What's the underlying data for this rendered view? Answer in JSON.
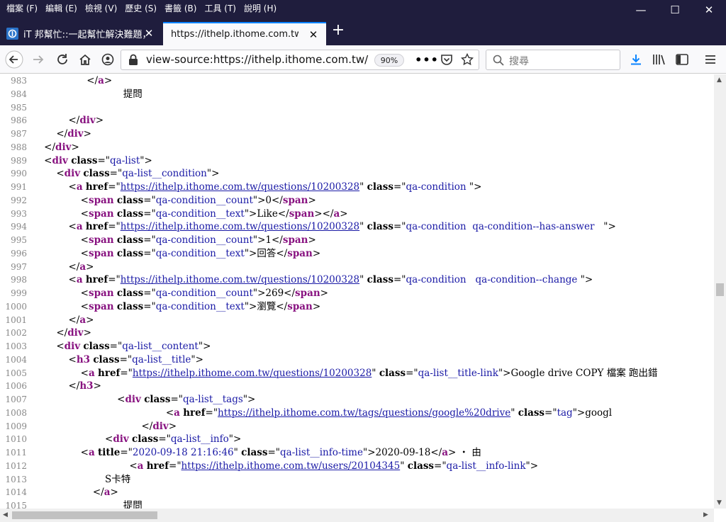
{
  "menu": [
    "檔案 (F)",
    "編輯 (E)",
    "檢視 (V)",
    "歷史 (S)",
    "書籤 (B)",
    "工具 (T)",
    "說明 (H)"
  ],
  "tabs": [
    {
      "title": "iT 邦幫忙::一起幫忙解決難題，拯救 IT 人的一天"
    },
    {
      "title": "https://ithelp.ithome.com.tw/"
    }
  ],
  "url": "view-source:https://ithelp.ithome.com.tw/",
  "zoom": "90%",
  "search_placeholder": "搜尋",
  "lines": [
    {
      "n": "983",
      "html": "                  &lt;/<span class='t'>a</span>&gt;"
    },
    {
      "n": "984",
      "html": "                              提問"
    },
    {
      "n": "985",
      "html": ""
    },
    {
      "n": "986",
      "html": "            &lt;/<span class='t'>div</span>&gt;"
    },
    {
      "n": "987",
      "html": "        &lt;/<span class='t'>div</span>&gt;"
    },
    {
      "n": "988",
      "html": "    &lt;/<span class='t'>div</span>&gt;"
    },
    {
      "n": "989",
      "html": "    &lt;<span class='t'>div</span> <span class='a'>class</span>=\"<span class='v'>qa-list</span>\"&gt;"
    },
    {
      "n": "990",
      "html": "        &lt;<span class='t'>div</span> <span class='a'>class</span>=\"<span class='v'>qa-list__condition</span>\"&gt;"
    },
    {
      "n": "991",
      "html": "            &lt;<span class='t'>a</span> <span class='a'>href</span>=\"<span class='lk'>https://ithelp.ithome.com.tw/questions/10200328</span>\" <span class='a'>class</span>=\"<span class='v'>qa-condition </span>\"&gt;"
    },
    {
      "n": "992",
      "html": "                &lt;<span class='t'>span</span> <span class='a'>class</span>=\"<span class='v'>qa-condition__count</span>\"&gt;0&lt;/<span class='t'>span</span>&gt;"
    },
    {
      "n": "993",
      "html": "                &lt;<span class='t'>span</span> <span class='a'>class</span>=\"<span class='v'>qa-condition__text</span>\"&gt;Like&lt;/<span class='t'>span</span>&gt;&lt;/<span class='t'>a</span>&gt;"
    },
    {
      "n": "994",
      "html": "            &lt;<span class='t'>a</span> <span class='a'>href</span>=\"<span class='lk'>https://ithelp.ithome.com.tw/questions/10200328</span>\" <span class='a'>class</span>=\"<span class='v'>qa-condition  qa-condition--has-answer   </span>\"&gt;"
    },
    {
      "n": "995",
      "html": "                &lt;<span class='t'>span</span> <span class='a'>class</span>=\"<span class='v'>qa-condition__count</span>\"&gt;1&lt;/<span class='t'>span</span>&gt;"
    },
    {
      "n": "996",
      "html": "                &lt;<span class='t'>span</span> <span class='a'>class</span>=\"<span class='v'>qa-condition__text</span>\"&gt;回答&lt;/<span class='t'>span</span>&gt;"
    },
    {
      "n": "997",
      "html": "            &lt;/<span class='t'>a</span>&gt;"
    },
    {
      "n": "998",
      "html": "            &lt;<span class='t'>a</span> <span class='a'>href</span>=\"<span class='lk'>https://ithelp.ithome.com.tw/questions/10200328</span>\" <span class='a'>class</span>=\"<span class='v'>qa-condition   qa-condition--change </span>\"&gt;"
    },
    {
      "n": "999",
      "html": "                &lt;<span class='t'>span</span> <span class='a'>class</span>=\"<span class='v'>qa-condition__count</span>\"&gt;269&lt;/<span class='t'>span</span>&gt;"
    },
    {
      "n": "1000",
      "html": "                &lt;<span class='t'>span</span> <span class='a'>class</span>=\"<span class='v'>qa-condition__text</span>\"&gt;瀏覽&lt;/<span class='t'>span</span>&gt;"
    },
    {
      "n": "1001",
      "html": "            &lt;/<span class='t'>a</span>&gt;"
    },
    {
      "n": "1002",
      "html": "        &lt;/<span class='t'>div</span>&gt;"
    },
    {
      "n": "1003",
      "html": "        &lt;<span class='t'>div</span> <span class='a'>class</span>=\"<span class='v'>qa-list__content</span>\"&gt;"
    },
    {
      "n": "1004",
      "html": "            &lt;<span class='t'>h3</span> <span class='a'>class</span>=\"<span class='v'>qa-list__title</span>\"&gt;"
    },
    {
      "n": "1005",
      "html": "                &lt;<span class='t'>a</span> <span class='a'>href</span>=\"<span class='lk'>https://ithelp.ithome.com.tw/questions/10200328</span>\" <span class='a'>class</span>=\"<span class='v'>qa-list__title-link</span>\"&gt;Google drive COPY 檔案 跑出錯"
    },
    {
      "n": "1006",
      "html": "            &lt;/<span class='t'>h3</span>&gt;"
    },
    {
      "n": "1007",
      "html": "                            &lt;<span class='t'>div</span> <span class='a'>class</span>=\"<span class='v'>qa-list__tags</span>\"&gt;"
    },
    {
      "n": "1008",
      "html": "                                            &lt;<span class='t'>a</span> <span class='a'>href</span>=\"<span class='lk'>https://ithelp.ithome.com.tw/tags/questions/google%20drive</span>\" <span class='a'>class</span>=\"<span class='v'>tag</span>\"&gt;googl"
    },
    {
      "n": "1009",
      "html": "                                    &lt;/<span class='t'>div</span>&gt;"
    },
    {
      "n": "1010",
      "html": "                        &lt;<span class='t'>div</span> <span class='a'>class</span>=\"<span class='v'>qa-list__info</span>\"&gt;"
    },
    {
      "n": "1011",
      "html": "                &lt;<span class='t'>a</span> <span class='a'>title</span>=\"<span class='v'>2020-09-18 21:16:46</span>\" <span class='a'>class</span>=\"<span class='v'>qa-list__info-time</span>\"&gt;2020-09-18&lt;/<span class='t'>a</span>&gt; ・ 由"
    },
    {
      "n": "1012",
      "html": "                                &lt;<span class='t'>a</span> <span class='a'>href</span>=\"<span class='lk'>https://ithelp.ithome.com.tw/users/20104345</span>\" <span class='a'>class</span>=\"<span class='v'>qa-list__info-link</span>\"&gt;"
    },
    {
      "n": "1013",
      "html": "                        S卡特"
    },
    {
      "n": "1014",
      "html": "                    &lt;/<span class='t'>a</span>&gt;"
    },
    {
      "n": "1015",
      "html": "                              提問"
    }
  ]
}
